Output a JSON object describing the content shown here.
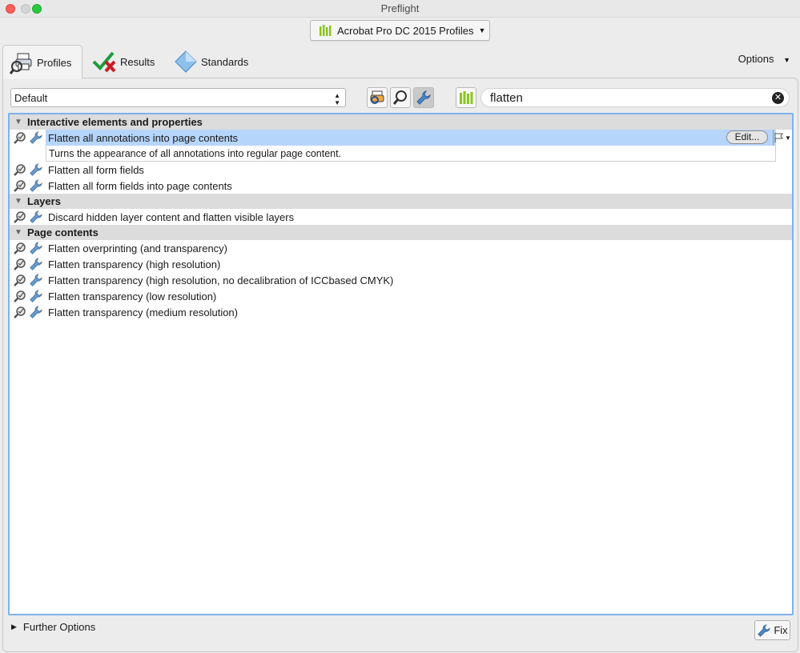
{
  "window": {
    "title": "Preflight"
  },
  "profile_selector": {
    "label": "Acrobat Pro DC 2015 Profiles"
  },
  "tabs": [
    {
      "label": "Profiles",
      "icon": "printer-magnifier-icon"
    },
    {
      "label": "Results",
      "icon": "checkmark-x-icon"
    },
    {
      "label": "Standards",
      "icon": "diamond-icon"
    }
  ],
  "options": {
    "label": "Options"
  },
  "preset": {
    "value": "Default"
  },
  "search": {
    "value": "flatten"
  },
  "groups": [
    {
      "title": "Interactive elements and properties",
      "items": [
        {
          "label": "Flatten all annotations into page contents",
          "selected": true,
          "description": "Turns the appearance of all annotations into regular page content.",
          "edit_label": "Edit..."
        },
        {
          "label": "Flatten all form fields"
        },
        {
          "label": "Flatten all form fields into page contents"
        }
      ]
    },
    {
      "title": "Layers",
      "items": [
        {
          "label": "Discard hidden layer content and flatten visible layers"
        }
      ]
    },
    {
      "title": "Page contents",
      "items": [
        {
          "label": "Flatten overprinting (and transparency)"
        },
        {
          "label": "Flatten transparency (high resolution)"
        },
        {
          "label": "Flatten transparency (high resolution, no decalibration of ICCbased CMYK)"
        },
        {
          "label": "Flatten transparency (low resolution)"
        },
        {
          "label": "Flatten transparency (medium resolution)"
        }
      ]
    }
  ],
  "further_options": {
    "label": "Further Options"
  },
  "fix_button": {
    "label": "Fix"
  },
  "colors": {
    "accent": "#7fb2ea",
    "selection": "#b6d5fb",
    "brand_green": "#8dc21f"
  }
}
